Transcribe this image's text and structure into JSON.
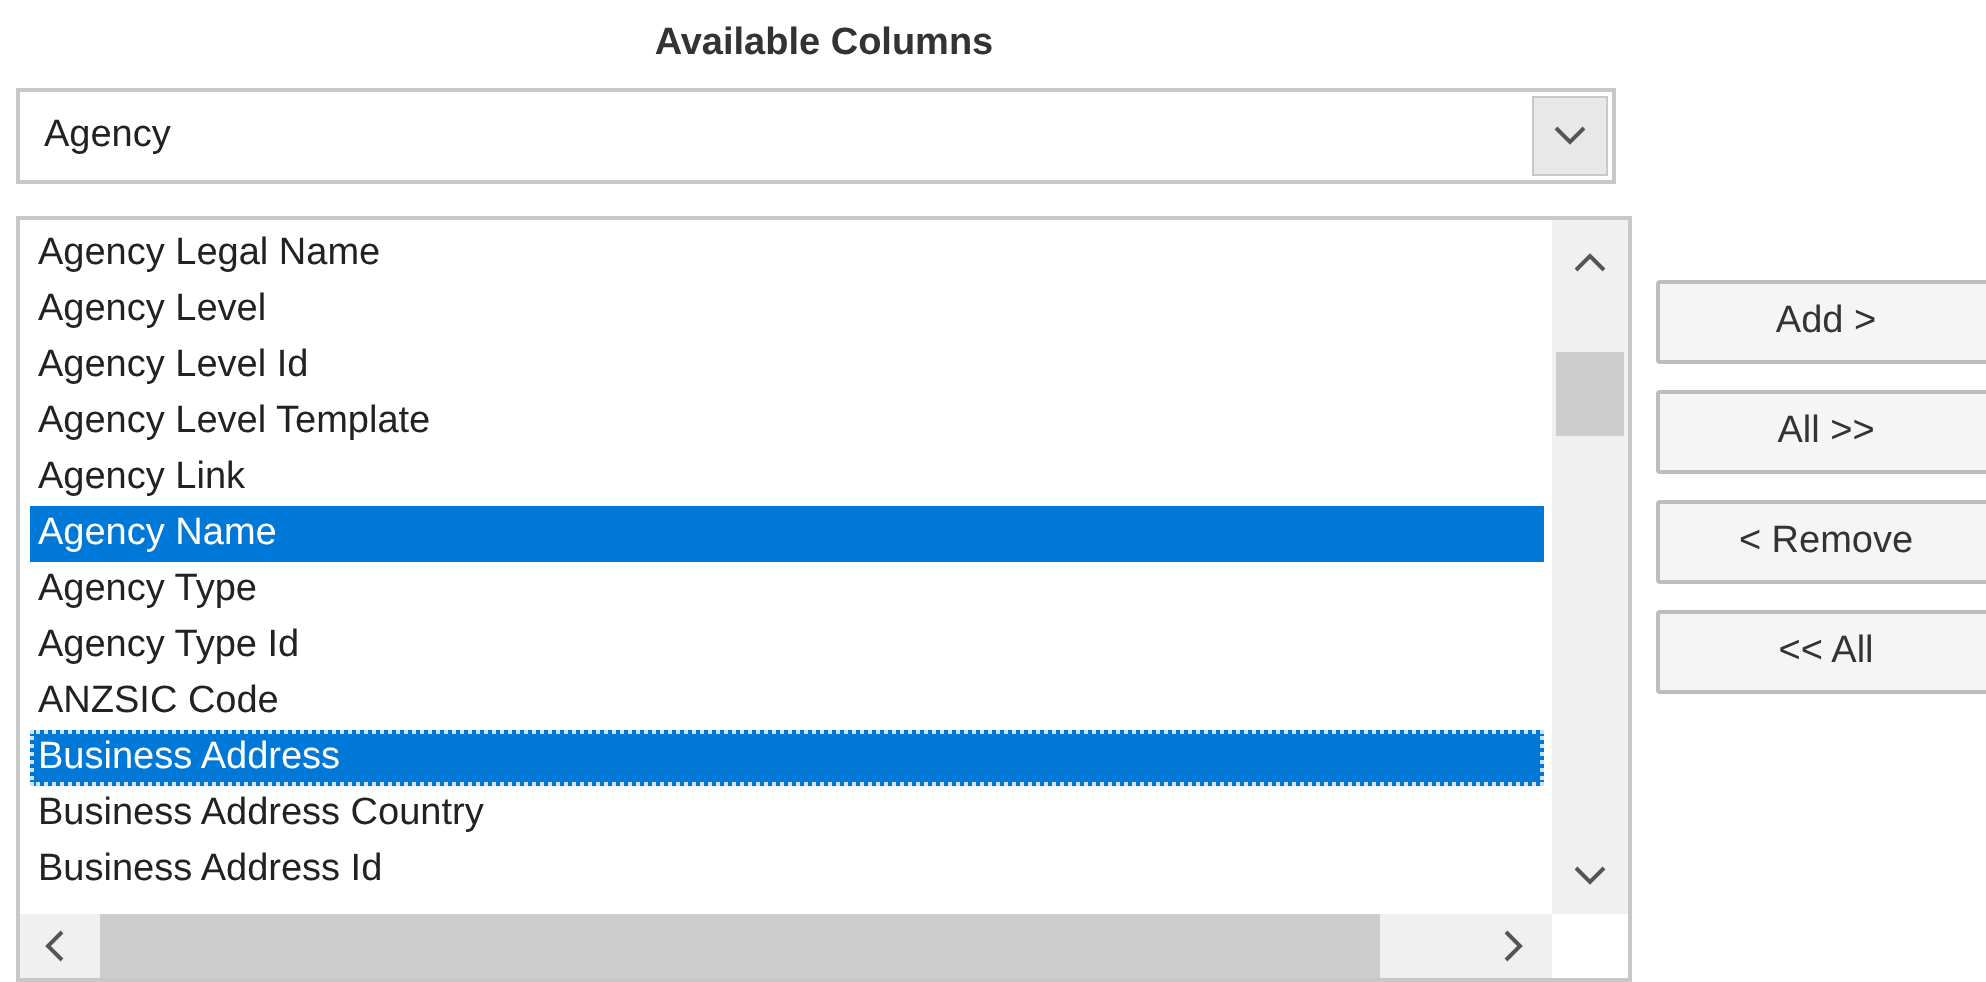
{
  "title": "Available Columns",
  "dropdown": {
    "value": "Agency"
  },
  "list": {
    "items": [
      {
        "label": "Agency Legal Name",
        "selected": false,
        "focused": false
      },
      {
        "label": "Agency Level",
        "selected": false,
        "focused": false
      },
      {
        "label": "Agency Level Id",
        "selected": false,
        "focused": false
      },
      {
        "label": "Agency Level Template",
        "selected": false,
        "focused": false
      },
      {
        "label": "Agency Link",
        "selected": false,
        "focused": false
      },
      {
        "label": "Agency Name",
        "selected": true,
        "focused": false
      },
      {
        "label": "Agency Type",
        "selected": false,
        "focused": false
      },
      {
        "label": "Agency Type Id",
        "selected": false,
        "focused": false
      },
      {
        "label": "ANZSIC Code",
        "selected": false,
        "focused": false
      },
      {
        "label": "Business Address",
        "selected": true,
        "focused": true
      },
      {
        "label": "Business Address Country",
        "selected": false,
        "focused": false
      },
      {
        "label": "Business Address Id",
        "selected": false,
        "focused": false
      }
    ]
  },
  "buttons": [
    "Add >",
    "All >>",
    "< Remove",
    "<< All"
  ]
}
